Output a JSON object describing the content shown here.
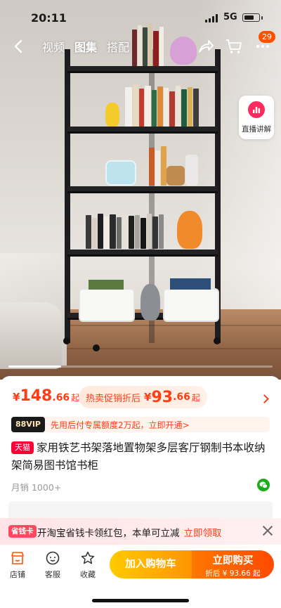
{
  "status_bar": {
    "time": "20:11",
    "network": "5G",
    "battery_level": 0.7
  },
  "nav": {
    "tabs": [
      {
        "label": "视频",
        "active": false
      },
      {
        "label": "图集",
        "active": true
      },
      {
        "label": "搭配",
        "active": false
      }
    ],
    "icons": [
      "back-icon",
      "share-icon",
      "cart-icon",
      "more-icon"
    ],
    "more_badge": "29"
  },
  "live": {
    "label": "直播讲解",
    "icon": "live-icon"
  },
  "gallery": {
    "progress": 0.2
  },
  "price": {
    "currency": "¥",
    "integer": "148",
    "decimal": ".66",
    "suffix": "起",
    "promo_label": "热卖促销折后",
    "promo_currency": "¥",
    "promo_integer": "93",
    "promo_decimal": ".66",
    "promo_suffix": "起"
  },
  "vip": {
    "badge": "88VIP",
    "text": "先用后付专属额度2万起，立即开通>"
  },
  "product": {
    "tag": "天猫",
    "title": "家用铁艺书架落地置物架多层客厅钢制书本收纳架简易图书馆书柜",
    "sales": "月销 1000+"
  },
  "coupon": {
    "tag": "省钱卡",
    "text": "开淘宝省钱卡领红包，本单可立减",
    "link": "立即领取"
  },
  "bottom_bar": {
    "shop": "店铺",
    "service": "客服",
    "favorite": "收藏",
    "add_to_cart": "加入购物车",
    "buy_now": "立即购买",
    "buy_sub": "折后 ¥ 93.66 起"
  },
  "colors": {
    "accent": "#ff3d14",
    "tmall": "#ff0036",
    "cart": "#ff9402",
    "buy": "#ff4900"
  }
}
